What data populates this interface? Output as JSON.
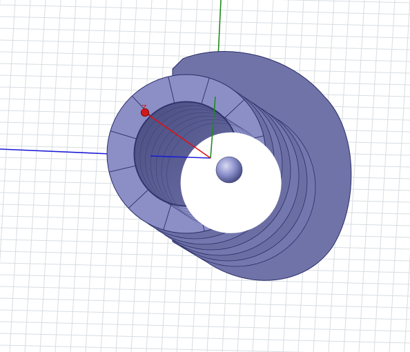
{
  "viewport": {
    "background": "#ffffff",
    "grid_color": "#d7dde2"
  },
  "colors": {
    "body_fill": "#8b8fc6",
    "body_side": "#6f73a8",
    "body_dark": "#4d5084",
    "edge": "#2a2d66",
    "x_axis": "#1a1ad6",
    "y_axis": "#1f8a1f",
    "z_axis": "#e01010",
    "sphere": "#8a8fca"
  },
  "axes": {
    "z_label": "Z"
  },
  "model": {
    "shape": "hollow-cylinder",
    "ring_segments": 12,
    "stack_layers": 6
  }
}
